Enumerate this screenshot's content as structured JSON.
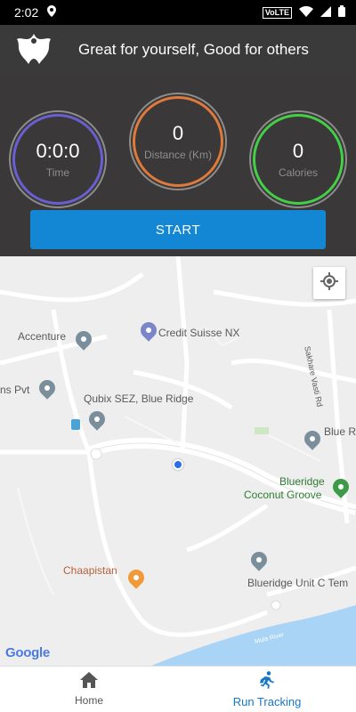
{
  "status_bar": {
    "time": "2:02",
    "network": "VoLTE"
  },
  "header": {
    "title": "Great for yourself, Good for others"
  },
  "stats": {
    "time": {
      "value": "0:0:0",
      "label": "Time"
    },
    "distance": {
      "value": "0",
      "label": "Distance (Km)"
    },
    "calories": {
      "value": "0",
      "label": "Calories"
    }
  },
  "start_button": {
    "label": "START"
  },
  "map": {
    "places": {
      "accenture": "Accenture",
      "credit_suisse": "Credit Suisse NX",
      "ins_pvt": "ns Pvt",
      "qubix": "Qubix SEZ, Blue Ridge",
      "blue_r": "Blue R",
      "blueridge_coconut_1": "Blueridge",
      "blueridge_coconut_2": "Coconut Groove",
      "chaapistan": "Chaapistan",
      "blueridge_unit": "Blueridge Unit C Tem",
      "sakhare_road": "Sakhare Vasti Rd",
      "mula_river": "Mula River"
    },
    "attribution": "Google"
  },
  "bottom_nav": {
    "home": "Home",
    "run_tracking": "Run Tracking"
  },
  "colors": {
    "accent": "#1386d4",
    "time_ring": "#6a5fd1",
    "distance_ring": "#e07a3a",
    "calories_ring": "#43d046"
  }
}
